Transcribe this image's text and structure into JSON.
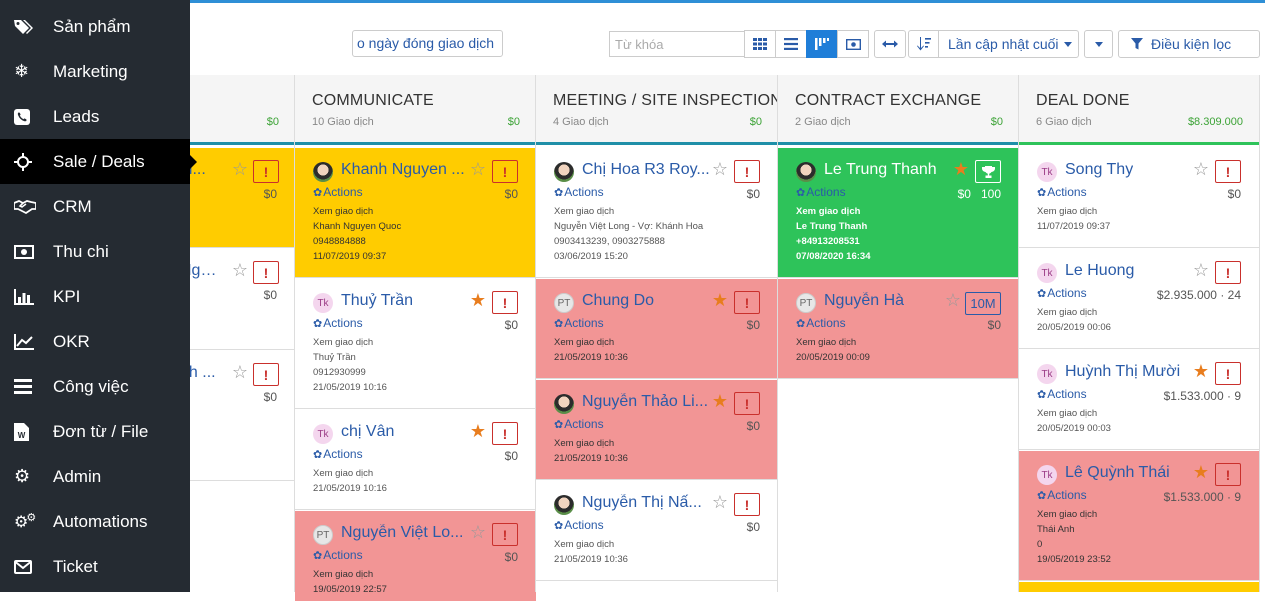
{
  "sidebar": {
    "items": [
      {
        "label": "Sản phẩm",
        "icon": "tags-icon"
      },
      {
        "label": "Marketing",
        "icon": "snowflake-icon"
      },
      {
        "label": "Leads",
        "icon": "phone-icon"
      },
      {
        "label": "Sale / Deals",
        "icon": "crosshair-icon",
        "active": true
      },
      {
        "label": "CRM",
        "icon": "handshake-icon"
      },
      {
        "label": "Thu chi",
        "icon": "money-icon"
      },
      {
        "label": "KPI",
        "icon": "bar-chart-icon"
      },
      {
        "label": "OKR",
        "icon": "line-chart-icon"
      },
      {
        "label": "Công việc",
        "icon": "list-icon"
      },
      {
        "label": "Đơn từ / File",
        "icon": "word-file-icon"
      },
      {
        "label": "Admin",
        "icon": "gear-icon"
      },
      {
        "label": "Automations",
        "icon": "gears-icon"
      },
      {
        "label": "Ticket",
        "icon": "envelope-icon"
      }
    ]
  },
  "toolbar": {
    "date_button": "o ngày đóng giao dịch",
    "search_placeholder": "Từ khóa",
    "sort_label": "Lần cập nhật cuối",
    "filter_label": "Điều kiện lọc"
  },
  "columns": [
    {
      "key": "partial",
      "total": "$0",
      "cards": [
        {
          "name": "Li...",
          "value": "$0"
        },
        {
          "name": "Ngu...",
          "value": "$0"
        },
        {
          "name": "nh ...",
          "value": "$0"
        }
      ]
    },
    {
      "title": "COMMUNICATE",
      "count": "10 Giao dịch",
      "total": "$0",
      "cards": [
        {
          "name": "Khanh Nguyen ...",
          "value": "$0",
          "actions": "Actions",
          "lines": [
            "Xem giao dịch",
            "Khanh Nguyen Quoc",
            "0948884888",
            "11/07/2019 09:37"
          ]
        },
        {
          "name": "Thuỷ Trần",
          "avatar": "Tk",
          "value": "$0",
          "actions": "Actions",
          "lines": [
            "Xem giao dịch",
            "Thuỷ Trần",
            "0912930999",
            "21/05/2019 10:16"
          ]
        },
        {
          "name": "chị Vân",
          "avatar": "Tk",
          "value": "$0",
          "actions": "Actions",
          "lines": [
            "Xem giao dịch",
            "21/05/2019 10:16"
          ]
        },
        {
          "name": "Nguyễn Việt Lo...",
          "avatar": "PT",
          "value": "$0",
          "actions": "Actions",
          "lines": [
            "Xem giao dịch",
            "19/05/2019 22:57"
          ]
        }
      ]
    },
    {
      "title": "MEETING / SITE INSPECTION",
      "count": "4 Giao dịch",
      "total": "$0",
      "cards": [
        {
          "name": "Chị Hoa R3 Roy...",
          "value": "$0",
          "actions": "Actions",
          "lines": [
            "Xem giao dịch",
            "Nguyễn Việt Long - Vợ: Khánh Hoa",
            "0903413239, 0903275888",
            "03/06/2019 15:20"
          ]
        },
        {
          "name": "Chung Do",
          "avatar": "PT",
          "value": "$0",
          "actions": "Actions",
          "lines": [
            "Xem giao dịch",
            "21/05/2019 10:36"
          ]
        },
        {
          "name": "Nguyễn Thảo Li...",
          "value": "$0",
          "actions": "Actions",
          "lines": [
            "Xem giao dịch",
            "21/05/2019 10:36"
          ]
        },
        {
          "name": "Nguyễn Thị Nấ...",
          "value": "$0",
          "actions": "Actions",
          "lines": [
            "Xem giao dịch",
            "21/05/2019 10:36"
          ]
        }
      ]
    },
    {
      "title": "CONTRACT EXCHANGE",
      "count": "2 Giao dịch",
      "total": "$0",
      "cards": [
        {
          "name": "Le Trung Thanh",
          "value": "$0",
          "score": "100",
          "actions": "Actions",
          "lines": [
            "Xem giao dịch",
            "Le Trung Thanh",
            "+84913208531",
            "07/08/2020 16:34"
          ]
        },
        {
          "name": "Nguyễn Hà",
          "avatar": "PT",
          "value": "$0",
          "badge": "10M",
          "actions": "Actions",
          "lines": [
            "Xem giao dịch",
            "20/05/2019 00:09"
          ]
        }
      ]
    },
    {
      "title": "DEAL DONE",
      "count": "6 Giao dịch",
      "total": "$8.309.000",
      "cards": [
        {
          "name": "Song Thy",
          "avatar": "Tk",
          "value": "$0",
          "actions": "Actions",
          "lines": [
            "Xem giao dịch",
            "11/07/2019 09:37"
          ]
        },
        {
          "name": "Le Huong",
          "avatar": "Tk",
          "value": "$2.935.000 · 24",
          "actions": "Actions",
          "lines": [
            "Xem giao dịch",
            "20/05/2019 00:06"
          ]
        },
        {
          "name": "Huỳnh Thị Mười",
          "avatar": "Tk",
          "value": "$1.533.000 · 9",
          "actions": "Actions",
          "lines": [
            "Xem giao dịch",
            "20/05/2019 00:03"
          ]
        },
        {
          "name": "Lê Quỳnh Thái",
          "avatar": "Tk",
          "value": "$1.533.000 · 9",
          "actions": "Actions",
          "lines": [
            "Xem giao dịch",
            "Thái Anh",
            "0",
            "19/05/2019 23:52"
          ]
        }
      ]
    }
  ]
}
